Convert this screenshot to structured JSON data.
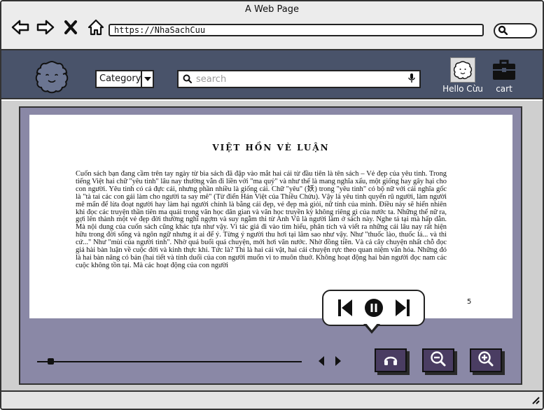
{
  "window": {
    "title": "A Web Page"
  },
  "browser": {
    "url": "https://NhaSachCuu",
    "nav_icons": [
      "back-arrow-icon",
      "forward-arrow-icon",
      "close-x-icon",
      "home-icon"
    ],
    "search_icon": "search-icon"
  },
  "header": {
    "logo_icon": "sheep-logo-icon",
    "category_label": "Category",
    "search_placeholder": "search",
    "user_label": "Hello Cừu",
    "cart_label": "cart",
    "bg_color": "#49536a"
  },
  "book": {
    "title": "VIỆT HỒN VÈ LUẬN",
    "text": "Cuốn sách bạn đang cầm trên tay ngày từ bìa sách đã đập vào mắt hai cái từ đầu tiên là tên sách – Vẻ đẹp của yêu tinh. Trong tiếng Việt hai chữ \"yêu tinh\" lâu nay thường vẫn đi liền với \"ma quỷ\" và như thế là mang nghĩa xấu, một giống hay gây hại cho con người. Yêu tinh có cả đực cái, nhưng phần nhiều là giống cái. Chữ \"yêu\" (妖) trong \"yêu tinh\" có bộ nữ với cái nghĩa gốc là \"tà tai các con gái làm cho người ta say mê\" (Từ điển Hán Việt của Thiều Chửu). Vậy là yêu tinh quyến rũ người, làm người mê mẩn để lừa đoạt người hay làm hại người chính là bằng cái đẹp, vẻ đẹp mà giỏi, nữ tính của mình. Điều này sẽ hiển nhiên khi đọc các truyện thần tiên ma quái trong văn học dân gian và văn học truyền kỳ không riêng gì của nước ta. Những thể nữ ra, gợi lên thành một vẻ đẹp đời thường nghĩ ngợm và suy ngẫm thi từ Anh Vũ là người làm ở sách này. Nghe tả tại mà hấp dẫn. Mà nội dung của cuốn sách cũng khác tựa như vậy. Vì tác giả đi vào tìm hiểu, phân tích và viết ra những cái lâu nay rất hiện hữu trong đời sống và ngôn ngữ nhưng ít ai để ý. Từng ý người thu hơi tại lâm sao như vậy. Như \"thuốc lào, thuốc lá... và thì cứ...\" Như \"mùi của người tình\". Nhờ quá buổi quá chuyện, mới hơi văn nước. Nhờ đồng tiền. Và cả cây chuyện nhất chỗ đọc giả hài bàn luận về cuộc đời và kinh thực khi. Tức là? Thì là hai cái vật, hai cái chuyện rực theo quan niệm văn hóa. Những đó là hai bàn nâng có bản (hai tiết và tính duối của con người muốn vì to muôn thuở. Không hoạt động hai bản người đọc nam các cuộc không tồn tại. Mà các hoạt động của con người",
    "page_number": "5"
  },
  "reader": {
    "progress": 0.05,
    "player_icons": [
      "skip-back-icon",
      "pause-icon",
      "skip-forward-icon"
    ],
    "pager_icons": [
      "page-prev-icon",
      "page-next-icon"
    ],
    "control_icons": [
      "headphones-icon",
      "zoom-out-icon",
      "zoom-in-icon"
    ],
    "control_color": "#4a3d62",
    "frame_color": "#8a88a6"
  }
}
